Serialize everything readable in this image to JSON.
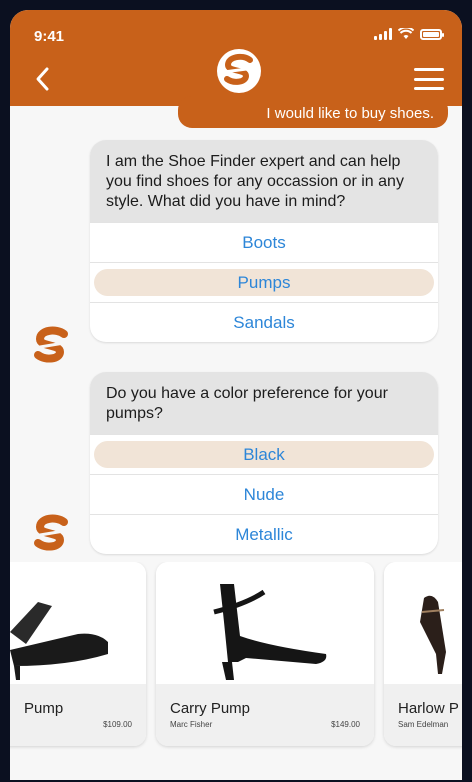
{
  "status_bar": {
    "time": "9:41"
  },
  "header": {
    "back_icon": "chevron-left-icon",
    "logo_icon": "shoe-finder-logo",
    "menu_icon": "hamburger-menu-icon"
  },
  "colors": {
    "brand": "#c8611a",
    "link": "#2d86d8",
    "selected": "#f1e4d7"
  },
  "chat": {
    "user_message": "I would like to buy shoes.",
    "q1": {
      "prompt": "I am the Shoe Finder expert and can help you find shoes for any occassion or in any style. What did you have in mind?",
      "options": [
        "Boots",
        "Pumps",
        "Sandals"
      ],
      "selected": "Pumps"
    },
    "q2": {
      "prompt": "Do you have a color preference for your pumps?",
      "options": [
        "Black",
        "Nude",
        "Metallic"
      ],
      "selected": "Black"
    }
  },
  "products": [
    {
      "name": "Pump",
      "brand": "",
      "price": "$109.00"
    },
    {
      "name": "Carry Pump",
      "brand": "Marc Fisher",
      "price": "$149.00"
    },
    {
      "name": "Harlow P",
      "brand": "Sam Edelman",
      "price": ""
    }
  ]
}
